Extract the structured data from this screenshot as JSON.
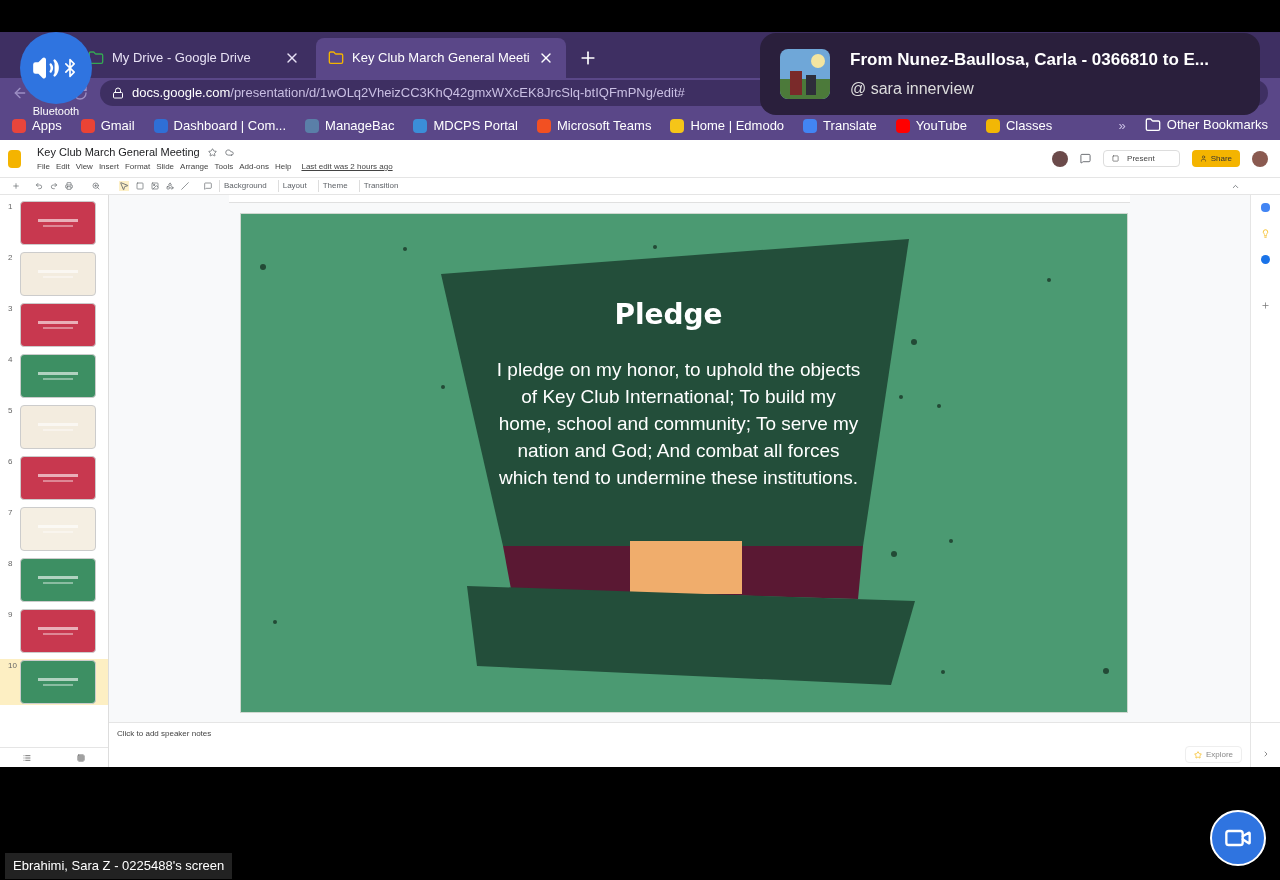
{
  "browser": {
    "tabs": [
      {
        "title": "My Drive - Google Drive",
        "selected": false
      },
      {
        "title": "Key Club March General Meeti",
        "selected": true
      }
    ],
    "url": {
      "host": "docs.google.com",
      "path": "/presentation/d/1wOLq2VheizCC3KhQ42gmxWXcEK8JrcSlq-btIQFmPNg/edit#"
    },
    "bookmarks": [
      {
        "label": "Apps",
        "color": "#e8453c"
      },
      {
        "label": "Gmail",
        "color": "#ea4335"
      },
      {
        "label": "Dashboard | Com...",
        "color": "#2f6fd6"
      },
      {
        "label": "ManageBac",
        "color": "#5a7fa8"
      },
      {
        "label": "MDCPS Portal",
        "color": "#3b8ed8"
      },
      {
        "label": "Microsoft Teams",
        "color": "#f25022"
      },
      {
        "label": "Home | Edmodo",
        "color": "#f5c518"
      },
      {
        "label": "Translate",
        "color": "#4285f4"
      },
      {
        "label": "YouTube",
        "color": "#ff0000"
      },
      {
        "label": "Classes",
        "color": "#f2b705"
      }
    ],
    "overflow": "»",
    "other": "Other Bookmarks"
  },
  "slides": {
    "title": "Key Club March General Meeting",
    "menu": [
      "File",
      "Edit",
      "View",
      "Insert",
      "Format",
      "Slide",
      "Arrange",
      "Tools",
      "Add-ons",
      "Help"
    ],
    "last_edit": "Last edit was 2 hours ago",
    "toolbar": [
      "Background",
      "Layout",
      "Theme",
      "Transition"
    ],
    "present": "Present",
    "share": "Share",
    "thumbnails": [
      {
        "number": "1",
        "color": "#c8384f",
        "selected": false
      },
      {
        "number": "2",
        "color": "#f3ecdf",
        "selected": false
      },
      {
        "number": "3",
        "color": "#c8384f",
        "selected": false
      },
      {
        "number": "4",
        "color": "#3d8f63",
        "selected": false
      },
      {
        "number": "5",
        "color": "#f3ecdf",
        "selected": false
      },
      {
        "number": "6",
        "color": "#c8384f",
        "selected": false
      },
      {
        "number": "7",
        "color": "#f5efe3",
        "selected": false
      },
      {
        "number": "8",
        "color": "#3d8f63",
        "selected": false
      },
      {
        "number": "9",
        "color": "#c8384f",
        "selected": false
      },
      {
        "number": "10",
        "color": "#3d8f63",
        "selected": true
      }
    ],
    "slide": {
      "heading": "Pledge",
      "body": "I pledge on my honor, to uphold the objects of Key Club International; To build my home, school and community; To serve my nation and God; And combat all forces which tend to undermine these institutions."
    },
    "notes_placeholder": "Click to add speaker notes",
    "explore": "Explore"
  },
  "overlays": {
    "bluetooth": "Bluetooth",
    "notification": {
      "title": "From Nunez-Baullosa, Carla - 0366810 to E...",
      "subtitle": "@ sara innerview"
    },
    "screen_caption": "Ebrahimi, Sara Z - 0225488's screen"
  }
}
